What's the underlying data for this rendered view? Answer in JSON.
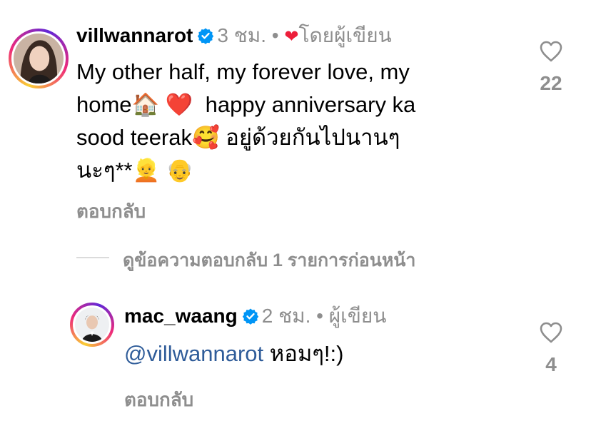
{
  "comment": {
    "username": "villwannarot",
    "time": "3 ชม.",
    "dot": "•",
    "liked_by_author_label": "โดยผู้เขียน",
    "lines": [
      "My other half, my forever love, my",
      "home",
      "happy anniversary ka",
      "sood teerak",
      "อยู่ด้วยกันไปนานๆ",
      "นะๆ**"
    ],
    "emoji": {
      "house": "🏠",
      "heart": "❤️",
      "smiling_hearts": "🥰",
      "man_blond": "👱",
      "old_man": "👴"
    },
    "reply_label": "ตอบกลับ",
    "like_count": "22",
    "heart_glyph": "❤"
  },
  "view_replies": "ดูข้อความตอบกลับ 1 รายการก่อนหน้า",
  "reply": {
    "username": "mac_waang",
    "time": "2 ชม.",
    "dot": "•",
    "author_label": "ผู้เขียน",
    "mention": "@villwannarot",
    "text": "หอมๆ!:)",
    "reply_label": "ตอบกลับ",
    "like_count": "4"
  },
  "colors": {
    "verified_blue": "#0095f6",
    "heart_red": "#ed1e3a",
    "meta_gray": "#8e8e8e",
    "mention_blue": "#2f5c99"
  }
}
